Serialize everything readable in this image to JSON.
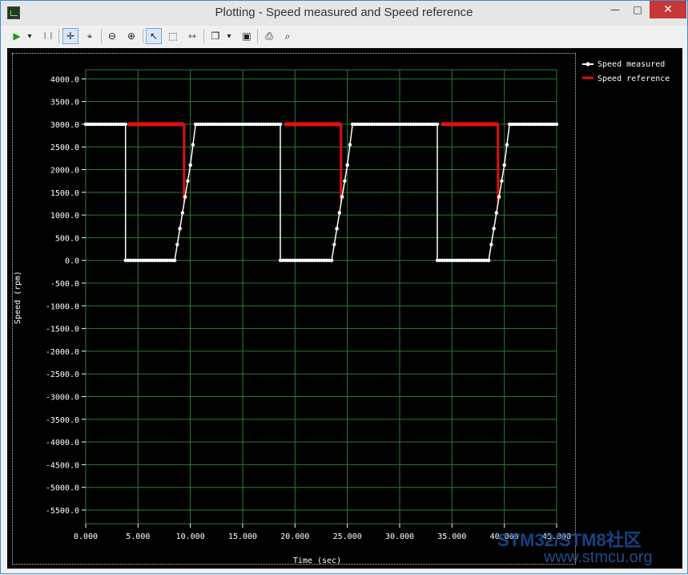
{
  "window": {
    "title": "Plotting  - Speed measured and Speed reference",
    "minimize_glyph": "—",
    "maximize_glyph": "□",
    "close_glyph": "✕"
  },
  "toolbar": {
    "play_glyph": "▶",
    "dropdown_glyph": "▾",
    "pause_glyph": "❙❙",
    "pan_glyph": "✛",
    "zoom_fit_glyph": "⌖",
    "zoom_out_glyph": "⊖",
    "zoom_in_glyph": "⊕",
    "pointer_glyph": "↖",
    "select_glyph": "⬚",
    "split_glyph": "⇿",
    "copy_glyph": "❐",
    "copy_dropdown_glyph": "▾",
    "save_glyph": "▣",
    "print_glyph": "⎙",
    "preview_glyph": "⌕"
  },
  "chart_data": {
    "type": "line",
    "xlabel": "Time (sec)",
    "ylabel": "Speed (rpm)",
    "xlim": [
      0,
      45
    ],
    "ylim": [
      -5800,
      4200
    ],
    "x_ticks": [
      0,
      5,
      10,
      15,
      20,
      25,
      30,
      35,
      40,
      45
    ],
    "x_tick_labels": [
      "0.000",
      "5.000",
      "10.000",
      "15.000",
      "20.000",
      "25.000",
      "30.000",
      "35.000",
      "40.000",
      "45.000"
    ],
    "y_ticks": [
      4000,
      3500,
      3000,
      2500,
      2000,
      1500,
      1000,
      500,
      0,
      -500,
      -1000,
      -1500,
      -2000,
      -2500,
      -3000,
      -3500,
      -4000,
      -4500,
      -5000,
      -5500
    ],
    "y_tick_labels": [
      "4000.0",
      "3500.0",
      "3000.0",
      "2500.0",
      "2000.0",
      "1500.0",
      "1000.0",
      "500.0",
      "0.0",
      "-500.0",
      "-1000.0",
      "-1500.0",
      "-2000.0",
      "-2500.0",
      "-3000.0",
      "-3500.0",
      "-4000.0",
      "-4500.0",
      "-5000.0",
      "-5500.0"
    ],
    "grid": true,
    "legend_position": "top-right",
    "colors": {
      "background": "#000000",
      "grid": "#2e7d32",
      "measured": "#ffffff",
      "reference": "#e01010",
      "text": "#ffffff"
    },
    "series": [
      {
        "name": "Speed measured",
        "x": [
          0,
          3.8,
          3.8,
          8.5,
          9.0,
          9.5,
          10.0,
          10.5,
          18.6,
          18.6,
          23.5,
          24.0,
          24.5,
          25.0,
          25.5,
          33.6,
          33.6,
          38.5,
          39.0,
          39.5,
          40.0,
          40.5,
          45
        ],
        "y": [
          3000,
          3000,
          0,
          0,
          700,
          1400,
          2100,
          3000,
          3000,
          0,
          0,
          700,
          1400,
          2100,
          3000,
          3000,
          0,
          0,
          700,
          1400,
          2100,
          3000,
          3000
        ]
      },
      {
        "name": "Speed reference",
        "x": [
          4.0,
          9.4,
          9.4,
          19.0,
          24.4,
          24.4,
          34.0,
          39.4,
          39.4
        ],
        "y": [
          3000,
          3000,
          1300,
          3000,
          3000,
          1300,
          3000,
          3000,
          1300
        ],
        "segments": [
          [
            4.0,
            9.4
          ],
          [
            19.0,
            24.4
          ],
          [
            34.0,
            39.4
          ]
        ]
      }
    ]
  },
  "watermark": {
    "line1": "STM32/STM8社区",
    "line2": "www.stmcu.org"
  }
}
